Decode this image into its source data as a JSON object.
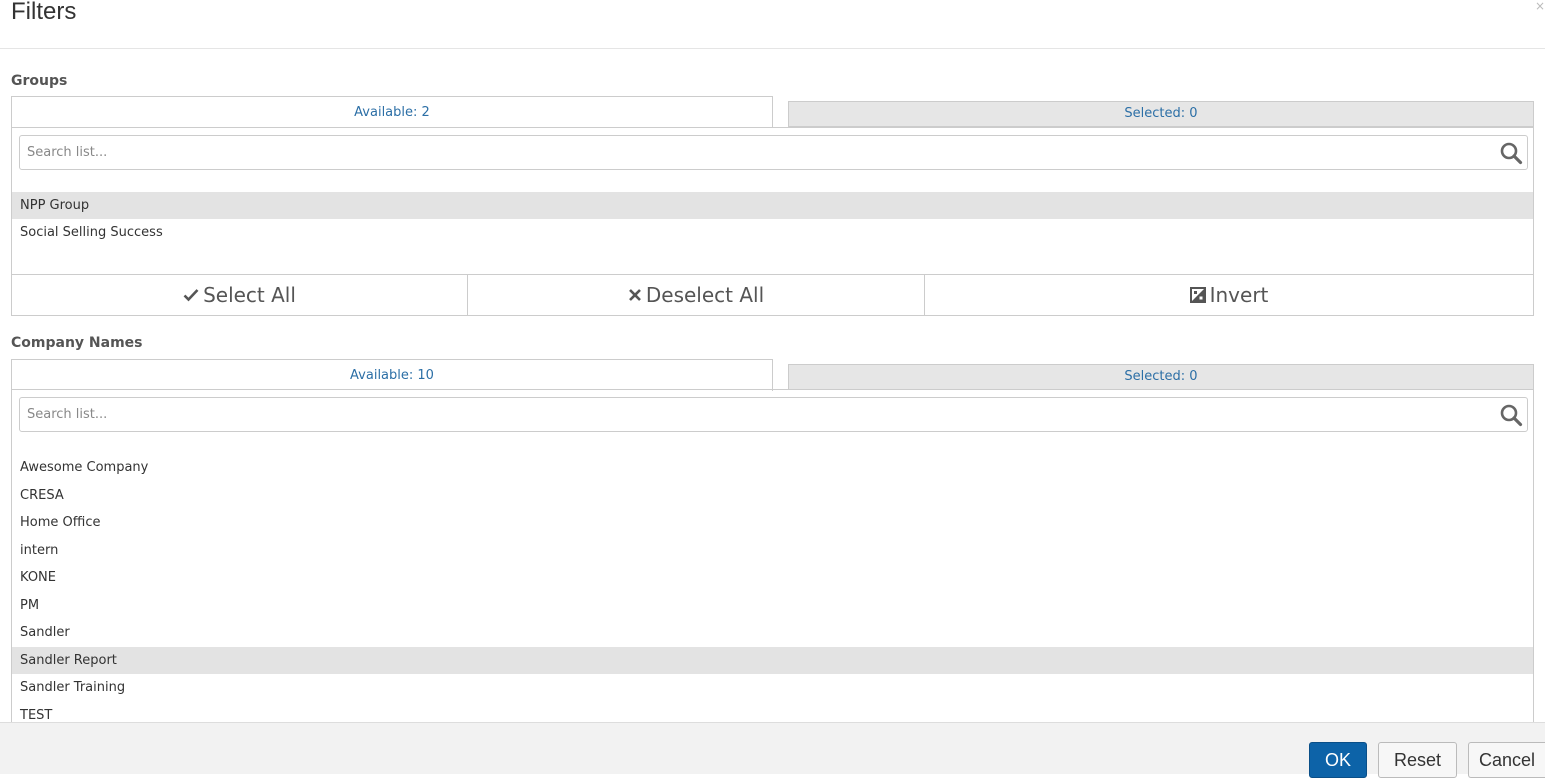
{
  "dialog": {
    "title": "Filters",
    "close_glyph": "×"
  },
  "groups": {
    "label": "Groups",
    "tab_available": "Available: 2",
    "tab_selected": "Selected: 0",
    "search_placeholder": "Search list...",
    "items": [
      {
        "label": "NPP Group",
        "highlighted": true
      },
      {
        "label": "Social Selling Success",
        "highlighted": false
      }
    ],
    "actions": {
      "select_all": "Select All",
      "deselect_all": "Deselect All",
      "invert": "Invert"
    }
  },
  "company_names": {
    "label": "Company Names",
    "tab_available": "Available: 10",
    "tab_selected": "Selected: 0",
    "search_placeholder": "Search list...",
    "items": [
      {
        "label": "Awesome Company",
        "highlighted": false
      },
      {
        "label": "CRESA",
        "highlighted": false
      },
      {
        "label": "Home Office",
        "highlighted": false
      },
      {
        "label": "intern",
        "highlighted": false
      },
      {
        "label": "KONE",
        "highlighted": false
      },
      {
        "label": "PM",
        "highlighted": false
      },
      {
        "label": "Sandler",
        "highlighted": false
      },
      {
        "label": "Sandler Report",
        "highlighted": true
      },
      {
        "label": "Sandler Training",
        "highlighted": false
      },
      {
        "label": "TEST",
        "highlighted": false
      }
    ]
  },
  "footer": {
    "ok": "OK",
    "reset": "Reset",
    "cancel": "Cancel"
  },
  "colors": {
    "accent": "#0d63a8",
    "tab_text": "#2c6fa6",
    "highlight_row": "#e3e3e3"
  },
  "icons": [
    "search-icon",
    "checkmark-icon",
    "x-icon",
    "invert-icon",
    "close-icon"
  ]
}
